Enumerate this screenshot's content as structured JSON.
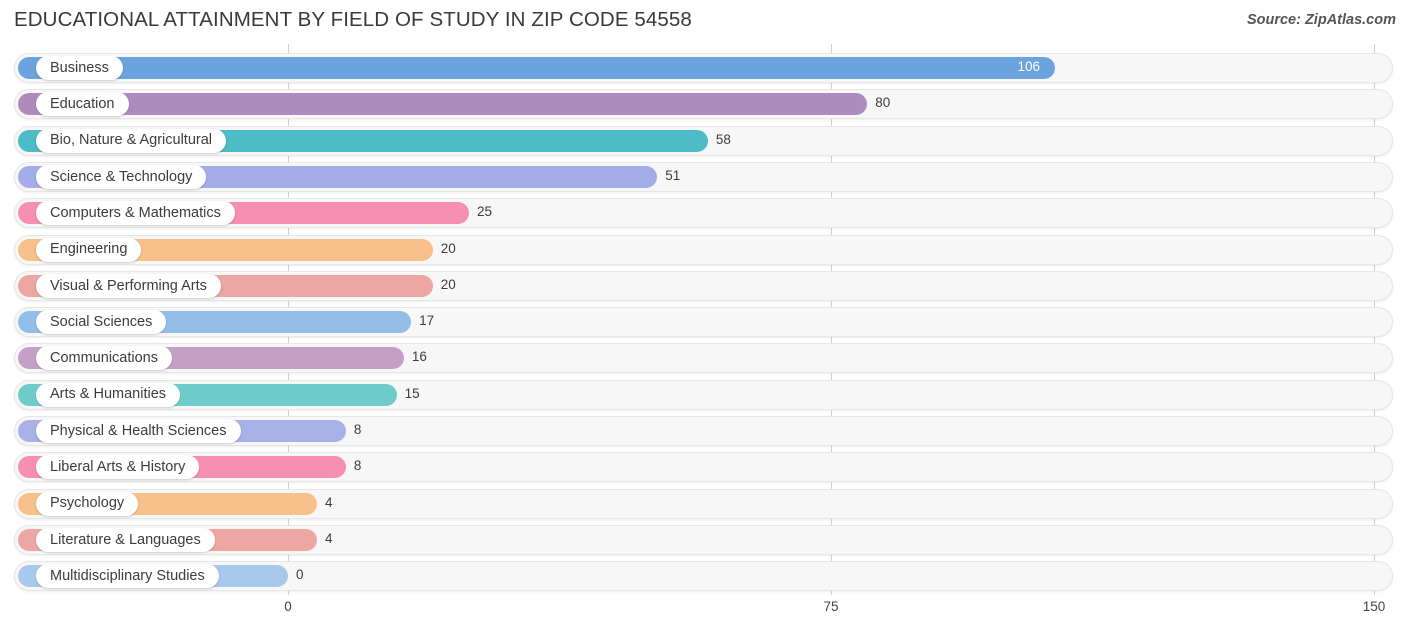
{
  "header": {
    "title": "EDUCATIONAL ATTAINMENT BY FIELD OF STUDY IN ZIP CODE 54558",
    "source": "Source: ZipAtlas.com"
  },
  "chart_data": {
    "type": "bar",
    "orientation": "horizontal",
    "title": "EDUCATIONAL ATTAINMENT BY FIELD OF STUDY IN ZIP CODE 54558",
    "subtitle": "Source: ZipAtlas.com",
    "xlabel": "",
    "ylabel": "",
    "xlim": [
      0,
      150
    ],
    "grid": true,
    "legend": false,
    "xticks": [
      0,
      75,
      150
    ],
    "xtick_labels": [
      "0",
      "75",
      "150"
    ],
    "categories": [
      "Business",
      "Education",
      "Bio, Nature & Agricultural",
      "Science & Technology",
      "Computers & Mathematics",
      "Engineering",
      "Visual & Performing Arts",
      "Social Sciences",
      "Communications",
      "Arts & Humanities",
      "Physical & Health Sciences",
      "Liberal Arts & History",
      "Psychology",
      "Literature & Languages",
      "Multidisciplinary Studies"
    ],
    "values": [
      106,
      80,
      58,
      51,
      25,
      20,
      20,
      17,
      16,
      15,
      8,
      8,
      4,
      4,
      0
    ],
    "value_labels": [
      "106",
      "80",
      "58",
      "51",
      "25",
      "20",
      "20",
      "17",
      "16",
      "15",
      "8",
      "8",
      "4",
      "4",
      "0"
    ],
    "colors": [
      "#6aa3dd",
      "#ad8cbd",
      "#4dbcc6",
      "#a3aee8",
      "#f78fb3",
      "#f8c08a",
      "#eda6a2",
      "#92bee8",
      "#c4a0c6",
      "#6ecccb",
      "#a8b1e8",
      "#f78fb3",
      "#f8c08a",
      "#eda6a2",
      "#a9c9ec"
    ],
    "bars": [
      {
        "label": "Business",
        "value": 106,
        "value_text": "106",
        "color": "#6aa3dd",
        "label_inside": true
      },
      {
        "label": "Education",
        "value": 80,
        "value_text": "80",
        "color": "#ad8cbd",
        "label_inside": false
      },
      {
        "label": "Bio, Nature & Agricultural",
        "value": 58,
        "value_text": "58",
        "color": "#4dbcc6",
        "label_inside": false
      },
      {
        "label": "Science & Technology",
        "value": 51,
        "value_text": "51",
        "color": "#a3aee8",
        "label_inside": false
      },
      {
        "label": "Computers & Mathematics",
        "value": 25,
        "value_text": "25",
        "color": "#f78fb3",
        "label_inside": false
      },
      {
        "label": "Engineering",
        "value": 20,
        "value_text": "20",
        "color": "#f8c08a",
        "label_inside": false
      },
      {
        "label": "Visual & Performing Arts",
        "value": 20,
        "value_text": "20",
        "color": "#eda6a2",
        "label_inside": false
      },
      {
        "label": "Social Sciences",
        "value": 17,
        "value_text": "17",
        "color": "#92bee8",
        "label_inside": false
      },
      {
        "label": "Communications",
        "value": 16,
        "value_text": "16",
        "color": "#c4a0c6",
        "label_inside": false
      },
      {
        "label": "Arts & Humanities",
        "value": 15,
        "value_text": "15",
        "color": "#6ecccb",
        "label_inside": false
      },
      {
        "label": "Physical & Health Sciences",
        "value": 8,
        "value_text": "8",
        "color": "#a8b1e8",
        "label_inside": false
      },
      {
        "label": "Liberal Arts & History",
        "value": 8,
        "value_text": "8",
        "color": "#f78fb3",
        "label_inside": false
      },
      {
        "label": "Psychology",
        "value": 4,
        "value_text": "4",
        "color": "#f8c08a",
        "label_inside": false
      },
      {
        "label": "Literature & Languages",
        "value": 4,
        "value_text": "4",
        "color": "#eda6a2",
        "label_inside": false
      },
      {
        "label": "Multidisciplinary Studies",
        "value": 0,
        "value_text": "0",
        "color": "#a9c9ec",
        "label_inside": false
      }
    ]
  }
}
